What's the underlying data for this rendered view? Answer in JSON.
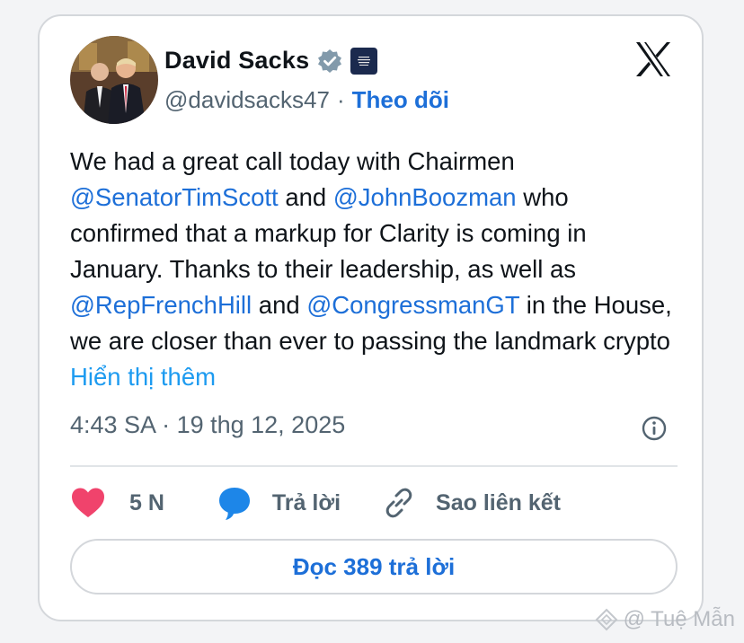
{
  "author": {
    "name": "David Sacks",
    "handle": "@davidsacks47",
    "separator": "·",
    "follow_label": "Theo dõi"
  },
  "tweet": {
    "text_1": "We had a great call today with Chairmen",
    "mention_1": "@SenatorTimScott",
    "text_2": " and ",
    "mention_2": "@JohnBoozman",
    "text_3": " who confirmed that a markup for Clarity is coming in January. Thanks to their leadership, as well as ",
    "mention_3": "@RepFrenchHill",
    "text_4": " and ",
    "mention_4": "@CongressmanGT",
    "text_5": " in the House, we are closer than ever to passing the landmark crypto ",
    "show_more": "Hiển thị thêm"
  },
  "meta": {
    "timestamp": "4:43 SA · 19 thg 12, 2025"
  },
  "actions": {
    "like_count": "5 N",
    "reply_label": "Trả lời",
    "copy_link_label": "Sao liên kết"
  },
  "read_replies_label": "Đọc 389 trả lời",
  "watermark": "@ Tuệ Mẫn",
  "icons": {
    "verified": "verified-badge-icon",
    "affiliation": "white-house-badge-icon",
    "x_logo": "x-logo-icon",
    "info": "info-icon",
    "like": "heart-icon",
    "reply": "speech-bubble-icon",
    "link": "link-icon"
  },
  "colors": {
    "link_blue": "#1d6fd8",
    "show_more_blue": "#1d9bf0",
    "heart_pink": "#f0436c",
    "secondary_text": "#536471"
  }
}
